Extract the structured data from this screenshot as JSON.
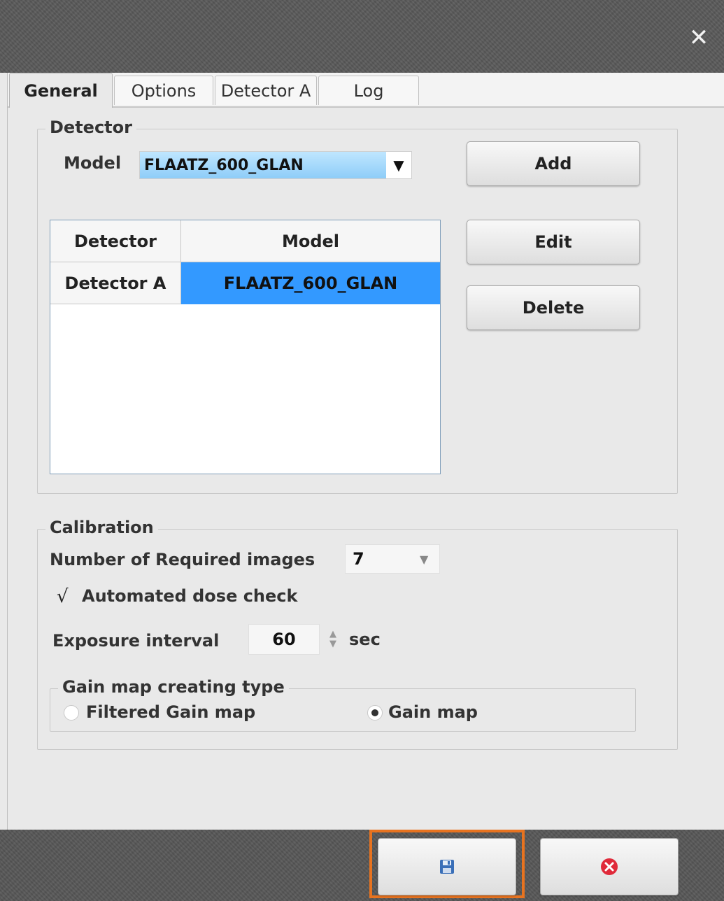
{
  "window": {
    "close_glyph": "✕"
  },
  "tabs": [
    {
      "label": "General",
      "active": true
    },
    {
      "label": "Options",
      "active": false
    },
    {
      "label": "Detector A",
      "active": false
    },
    {
      "label": "Log",
      "active": false
    }
  ],
  "detector": {
    "legend": "Detector",
    "model_label": "Model",
    "model_value": "FLAATZ_600_GLAN",
    "add_label": "Add",
    "edit_label": "Edit",
    "delete_label": "Delete",
    "table": {
      "headers": [
        "Detector",
        "Model"
      ],
      "rows": [
        [
          "Detector A",
          "FLAATZ_600_GLAN"
        ]
      ]
    }
  },
  "calibration": {
    "legend": "Calibration",
    "required_images_label": "Number of Required images",
    "required_images_value": "7",
    "dose_check_label": "Automated dose check",
    "dose_check_checked": true,
    "exposure_label": "Exposure interval",
    "exposure_value": "60",
    "exposure_unit": "sec",
    "gain_map": {
      "legend": "Gain map creating type",
      "options": [
        "Filtered Gain map",
        "Gain map"
      ],
      "selected": "Gain map"
    }
  },
  "footer": {
    "save_icon": "save-icon",
    "cancel_icon": "cancel-icon",
    "highlight_color": "#e8731f"
  },
  "colors": {
    "selection": "#3399ff",
    "combo_selected": "#8fd0ff"
  }
}
